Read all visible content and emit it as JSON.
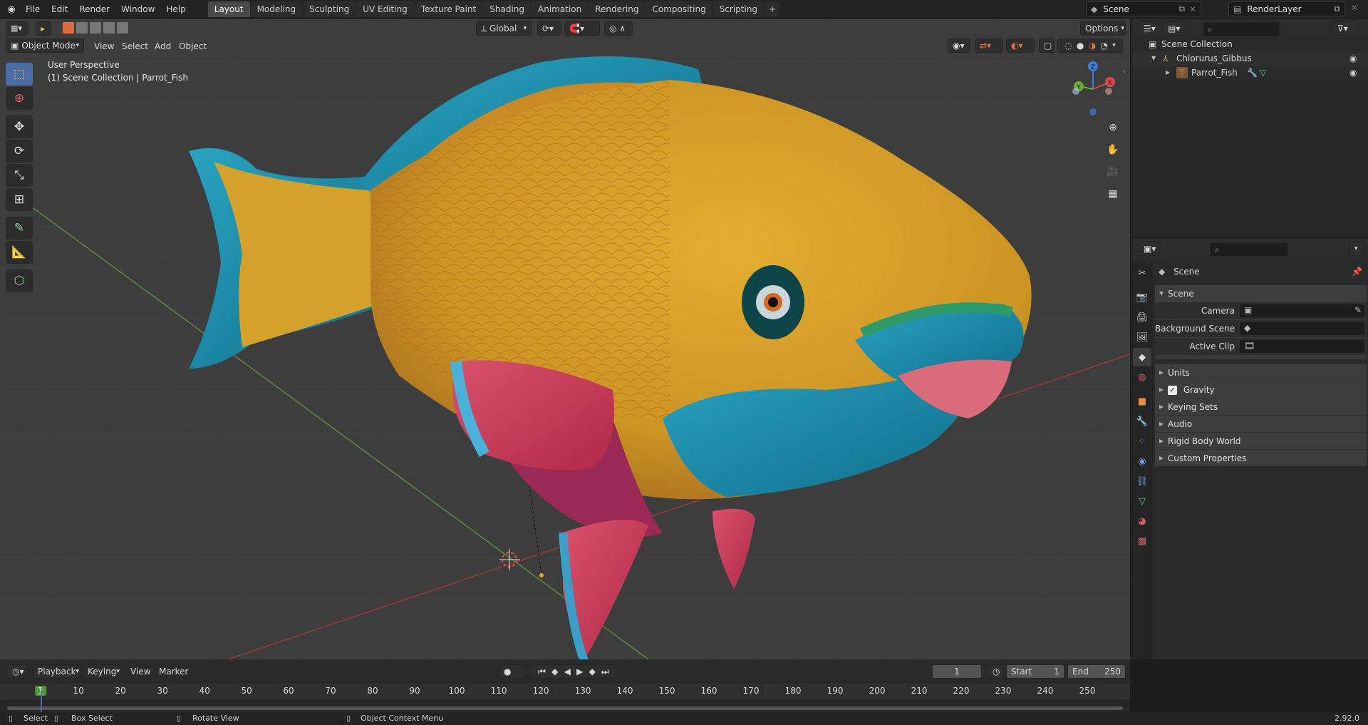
{
  "topbar": {
    "menus": [
      "File",
      "Edit",
      "Render",
      "Window",
      "Help"
    ],
    "workspaces": [
      "Layout",
      "Modeling",
      "Sculpting",
      "UV Editing",
      "Texture Paint",
      "Shading",
      "Animation",
      "Rendering",
      "Compositing",
      "Scripting"
    ],
    "active_workspace": "Layout",
    "scene_name": "Scene",
    "view_layer_name": "RenderLayer"
  },
  "viewport": {
    "mode": "Object Mode",
    "menus": [
      "View",
      "Select",
      "Add",
      "Object"
    ],
    "transform_orientation": "Global",
    "options_label": "Options",
    "overlay_title": "User Perspective",
    "overlay_subtitle": "(1) Scene Collection | Parrot_Fish",
    "gizmo_axes": {
      "x": "X",
      "y": "Y",
      "z": "Z"
    },
    "tools": [
      "select-box",
      "cursor",
      "move",
      "rotate",
      "scale",
      "transform",
      "annotate",
      "measure",
      "add-cube"
    ]
  },
  "outliner": {
    "root": "Scene Collection",
    "collection": "Chlorurus_Gibbus",
    "object": "Parrot_Fish"
  },
  "properties": {
    "context": "Scene",
    "panel_title": "Scene",
    "fields": {
      "camera_label": "Camera",
      "background_scene_label": "Background Scene",
      "active_clip_label": "Active Clip"
    },
    "subpanels": [
      "Units",
      "Gravity",
      "Keying Sets",
      "Audio",
      "Rigid Body World",
      "Custom Properties"
    ],
    "gravity_checked": true
  },
  "timeline": {
    "menus": [
      "Playback",
      "Keying",
      "View",
      "Marker"
    ],
    "current_frame": "1",
    "start_label": "Start",
    "start_value": "1",
    "end_label": "End",
    "end_value": "250",
    "ruler_ticks": [
      "1",
      "10",
      "20",
      "30",
      "40",
      "50",
      "60",
      "70",
      "80",
      "90",
      "100",
      "110",
      "120",
      "130",
      "140",
      "150",
      "160",
      "170",
      "180",
      "190",
      "200",
      "210",
      "220",
      "230",
      "240",
      "250"
    ]
  },
  "statusbar": {
    "select": "Select",
    "box_select": "Box Select",
    "rotate_view": "Rotate View",
    "context_menu": "Object Context Menu",
    "version": "2.92.0"
  },
  "colors": {
    "accent": "#4772b3",
    "active_tab": "#4a4a4a",
    "viewport_bg": "#3d3d3d",
    "fish_body": "#d4a22a",
    "fish_blue": "#1f8aa8",
    "fish_red": "#c0344f"
  }
}
